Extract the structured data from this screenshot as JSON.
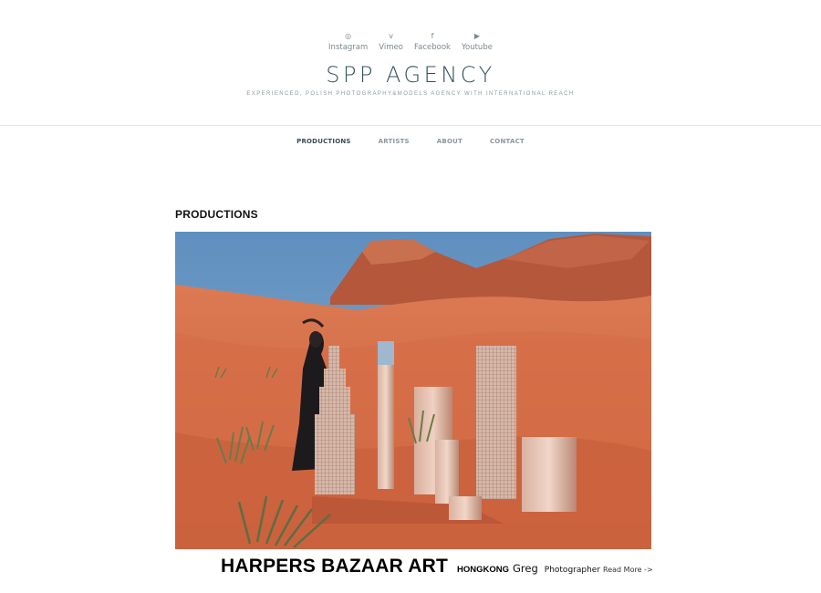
{
  "social": [
    {
      "label": "Instagram",
      "icon": "instagram-icon",
      "glyph": "◎"
    },
    {
      "label": "Vimeo",
      "icon": "vimeo-icon",
      "glyph": "v"
    },
    {
      "label": "Facebook",
      "icon": "facebook-icon",
      "glyph": "f"
    },
    {
      "label": "Youtube",
      "icon": "youtube-icon",
      "glyph": "▶"
    }
  ],
  "brand": {
    "name": "SPP AGENCY",
    "tagline": "EXPERIENCED, POLISH PHOTOGRAPHY&MODELS AGENCY WITH INTERNATIONAL REACH"
  },
  "nav": {
    "items": [
      {
        "label": "PRODUCTIONS",
        "active": true
      },
      {
        "label": "ARTISTS",
        "active": false
      },
      {
        "label": "ABOUT",
        "active": false
      },
      {
        "label": "CONTACT",
        "active": false
      }
    ]
  },
  "main": {
    "section_title": "PRODUCTIONS",
    "production": {
      "title": "HARPERS BAZAAR ART",
      "location": "HONGKONG",
      "name": "Greg",
      "role": "Photographer",
      "read_more": "Read More ->"
    }
  },
  "colors": {
    "brand": "#35525a",
    "nav_active": "#3c4b52",
    "nav_inactive": "#8a979e",
    "sky": "#6f9bc4",
    "sand": "#d8714b"
  }
}
